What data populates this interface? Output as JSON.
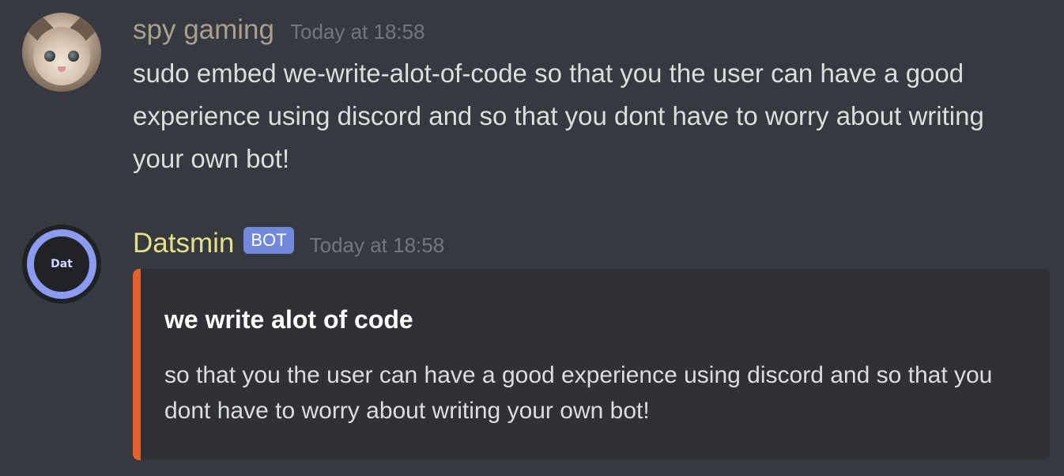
{
  "messages": [
    {
      "avatar_icon": "cat-avatar-icon",
      "username": "spy gaming",
      "timestamp": "Today at 18:58",
      "content": "sudo embed we-write-alot-of-code so that you the user can have a good experience using discord and so that you dont have to worry about writing your own bot!"
    },
    {
      "avatar_icon": "bot-avatar-icon",
      "avatar_text": "Dat",
      "username": "Datsmin",
      "badge": "BOT",
      "timestamp": "Today at 18:58",
      "embed": {
        "title": "we write alot of code",
        "description": "so that you the user can have a good experience using discord and so that you dont have to worry about writing your own bot!",
        "accent_color": "#e0632b"
      }
    }
  ],
  "colors": {
    "background": "#36393f",
    "embed_background": "#2f3136",
    "bot_badge": "#7289da",
    "username_spy": "#a89f8f",
    "username_bot": "#e3e28a",
    "timestamp": "#72767d",
    "text": "#dcddde"
  }
}
